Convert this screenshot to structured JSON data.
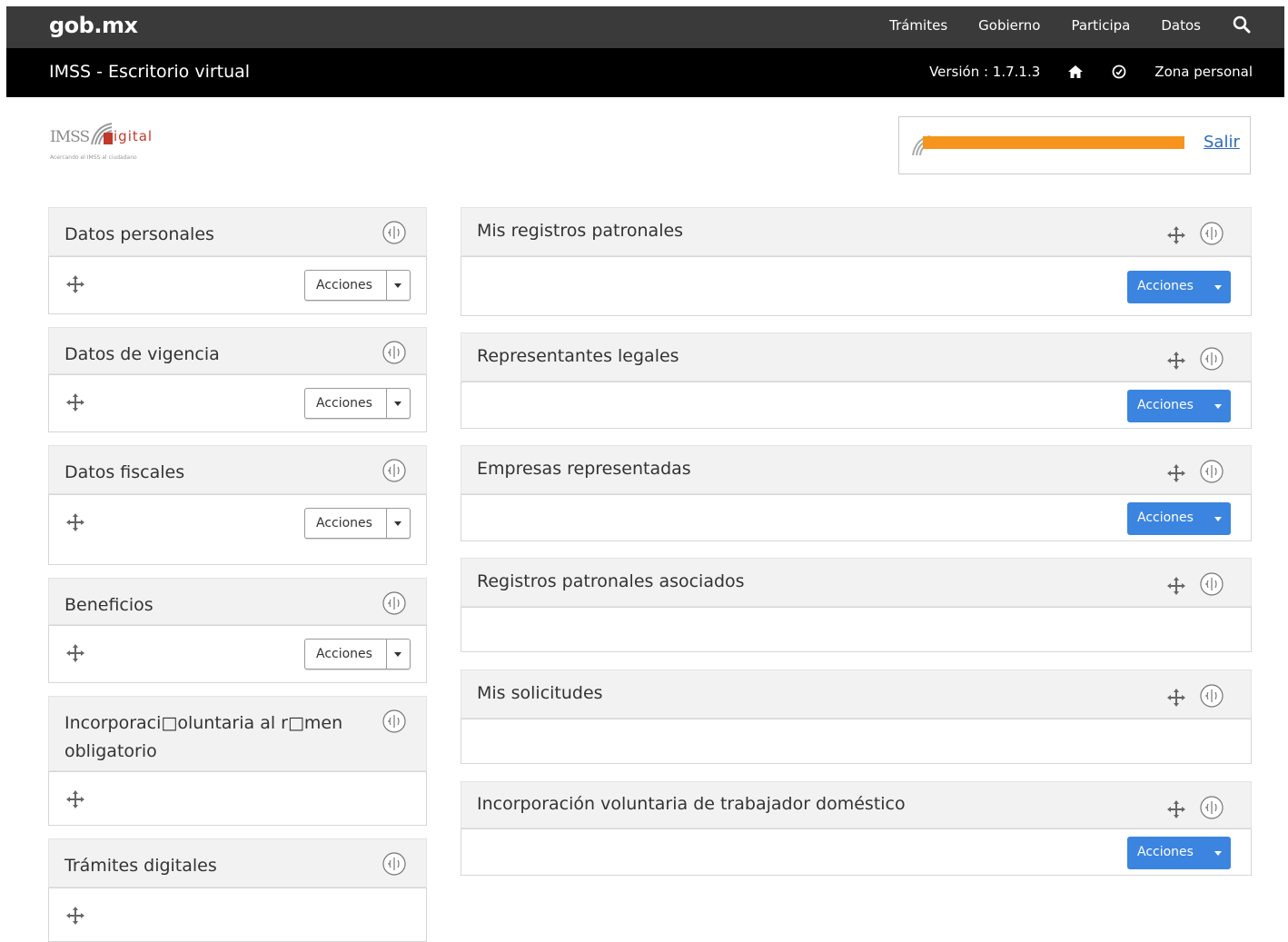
{
  "topbar": {
    "logo": "gob.mx",
    "nav": [
      "Trámites",
      "Gobierno",
      "Participa",
      "Datos"
    ],
    "search_icon": "search-icon"
  },
  "subbar": {
    "title": "IMSS - Escritorio virtual",
    "version": "Versión : 1.7.1.3",
    "home_icon": "home-icon",
    "clock_icon": "clock-icon",
    "zona": "Zona personal"
  },
  "brand": {
    "imss": "IMSS",
    "digital": "igital",
    "tagline": "Acercando el IMSS al ciudadano"
  },
  "user": {
    "logout": "Salir"
  },
  "common": {
    "acciones": "Acciones"
  },
  "left_panels": [
    {
      "title": "Datos personales"
    },
    {
      "title": "Datos de vigencia"
    },
    {
      "title": "Datos fiscales"
    },
    {
      "title": "Beneficios"
    },
    {
      "title": "Incorporaci□oluntaria al r□men obligatorio"
    },
    {
      "title": "Trámites digitales"
    }
  ],
  "right_panels": [
    {
      "title": "Mis registros patronales"
    },
    {
      "title": "Representantes legales"
    },
    {
      "title": "Empresas representadas"
    },
    {
      "title": "Registros patronales asociados"
    },
    {
      "title": "Mis solicitudes"
    },
    {
      "title": "Incorporación voluntaria de trabajador doméstico"
    }
  ],
  "colors": {
    "topbar": "#3a3a3a",
    "subbar": "#000000",
    "accent_blue": "#3b84e0",
    "redaction": "#f7941d"
  }
}
